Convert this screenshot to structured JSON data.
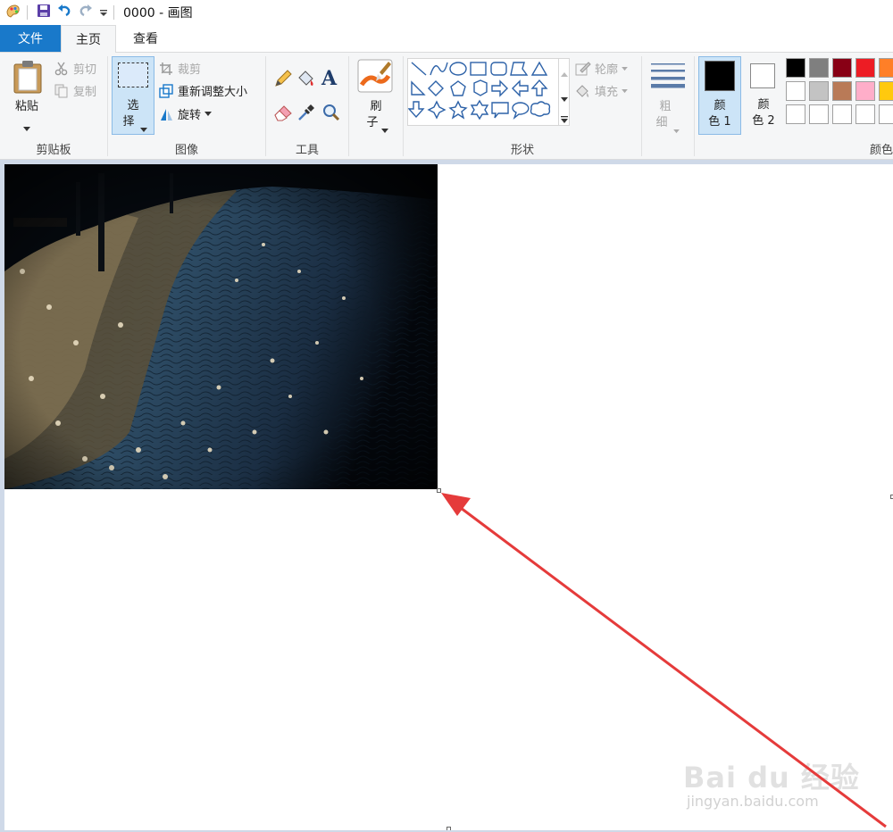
{
  "window": {
    "title": "0000 - 画图"
  },
  "tabs": {
    "file": "文件",
    "home": "主页",
    "view": "查看"
  },
  "clipboard": {
    "paste": "粘贴",
    "cut": "剪切",
    "copy": "复制",
    "group": "剪贴板"
  },
  "image": {
    "select_top": "选",
    "select_bottom": "择",
    "crop": "裁剪",
    "resize": "重新调整大小",
    "rotate": "旋转",
    "group": "图像"
  },
  "tools": {
    "group": "工具"
  },
  "brushes": {
    "top": "刷",
    "bottom": "子"
  },
  "shapes": {
    "outline": "轮廓",
    "fill": "填充",
    "group": "形状"
  },
  "size": {
    "top": "粗",
    "bottom": "细"
  },
  "colors": {
    "color1_top": "颜",
    "color1_bottom": "色 1",
    "color2_top": "颜",
    "color2_bottom": "色 2",
    "group": "颜色",
    "current1": "#000000",
    "current2": "#ffffff",
    "palette_row1": [
      "#000000",
      "#7f7f7f",
      "#880015",
      "#ed1c24",
      "#ff7f27"
    ],
    "palette_row2": [
      "#ffffff",
      "#c3c3c3",
      "#b97a57",
      "#ffaec9",
      "#ffc90e"
    ],
    "palette_row3": [
      "#ffffff",
      "#ffffff",
      "#ffffff",
      "#ffffff",
      "#ffffff"
    ]
  },
  "annotation": {
    "arrow_color": "#e53b3b"
  },
  "watermark": {
    "main": "Bai du 经验",
    "sub": "jingyan.baidu.com"
  }
}
